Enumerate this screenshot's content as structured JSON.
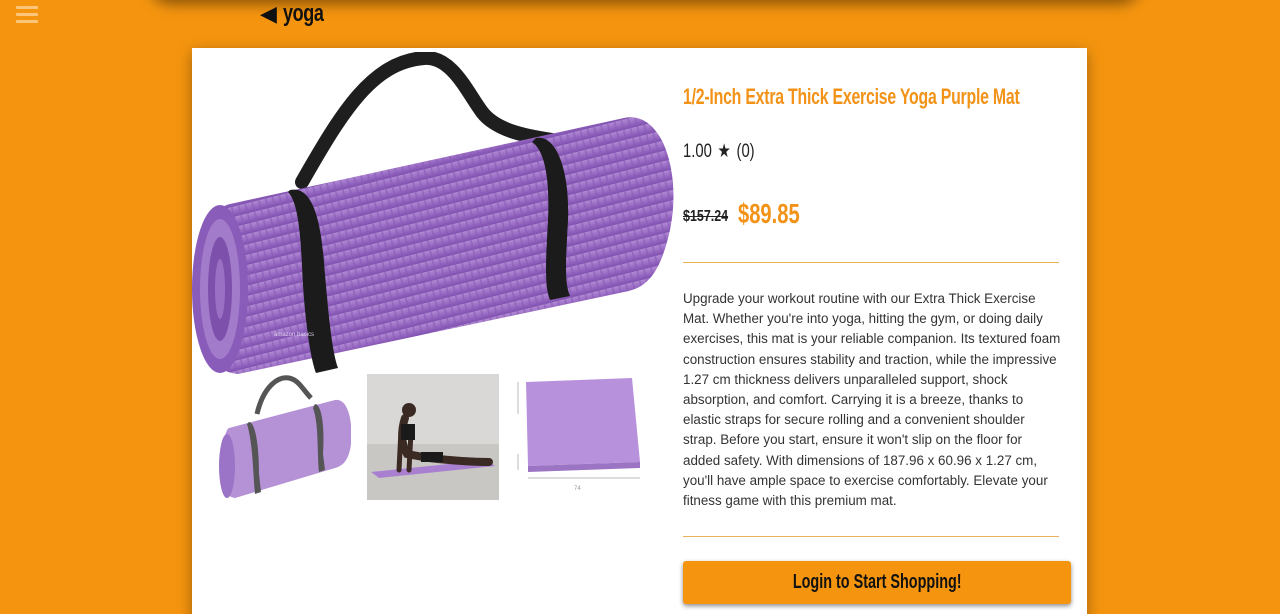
{
  "nav": {
    "menu_icon": "hamburger-icon",
    "back_icon": "back-triangle-icon",
    "back_glyph": "◀",
    "back_label": "yoga"
  },
  "product": {
    "title": "1/2-Inch Extra Thick Exercise Yoga Purple Mat",
    "rating_value": "1.00",
    "rating_star": "★",
    "rating_count": "(0)",
    "old_price": "$157.24",
    "price": "$89.85",
    "description": "Upgrade your workout routine with our Extra Thick Exercise Mat. Whether you're into yoga, hitting the gym, or doing daily exercises, this mat is your reliable companion. Its textured foam construction ensures stability and traction, while the impressive 1.27 cm thickness delivers unparalleled support, shock absorption, and comfort. Carrying it is a breeze, thanks to elastic straps for secure rolling and a convenient shoulder strap. Before you start, ensure it won't slip on the floor for added safety. With dimensions of 187.96 x 60.96 x 1.27 cm, you'll have ample space to exercise comfortably. Elevate your fitness game with this premium mat.",
    "login_button": "Login to Start Shopping!"
  },
  "colors": {
    "background": "#f5950f",
    "accent": "#f29318",
    "mat_purple": "#9c6fc4",
    "card": "#ffffff"
  }
}
